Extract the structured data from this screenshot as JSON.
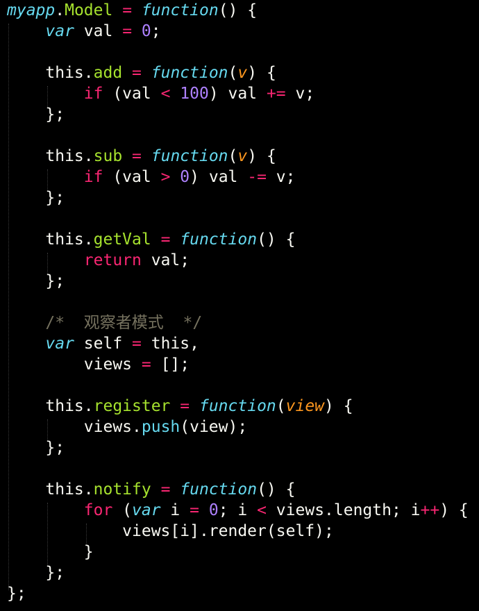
{
  "editor": {
    "lines": [
      [
        {
          "t": "myapp",
          "c": "obj"
        },
        {
          "t": ".",
          "c": "plain"
        },
        {
          "t": "Model",
          "c": "prop"
        },
        {
          "t": " ",
          "c": "plain"
        },
        {
          "t": "=",
          "c": "op"
        },
        {
          "t": " ",
          "c": "plain"
        },
        {
          "t": "function",
          "c": "fn"
        },
        {
          "t": "() {",
          "c": "plain"
        }
      ],
      [
        {
          "t": "    ",
          "c": "plain"
        },
        {
          "t": "var",
          "c": "kw"
        },
        {
          "t": " val ",
          "c": "plain"
        },
        {
          "t": "=",
          "c": "op"
        },
        {
          "t": " ",
          "c": "plain"
        },
        {
          "t": "0",
          "c": "num"
        },
        {
          "t": ";",
          "c": "plain"
        }
      ],
      [],
      [
        {
          "t": "    this.",
          "c": "plain"
        },
        {
          "t": "add",
          "c": "prop"
        },
        {
          "t": " ",
          "c": "plain"
        },
        {
          "t": "=",
          "c": "op"
        },
        {
          "t": " ",
          "c": "plain"
        },
        {
          "t": "function",
          "c": "fn"
        },
        {
          "t": "(",
          "c": "plain"
        },
        {
          "t": "v",
          "c": "param"
        },
        {
          "t": ") {",
          "c": "plain"
        }
      ],
      [
        {
          "t": "        ",
          "c": "plain"
        },
        {
          "t": "if",
          "c": "ctrl"
        },
        {
          "t": " (val ",
          "c": "plain"
        },
        {
          "t": "<",
          "c": "op"
        },
        {
          "t": " ",
          "c": "plain"
        },
        {
          "t": "100",
          "c": "num"
        },
        {
          "t": ") val ",
          "c": "plain"
        },
        {
          "t": "+=",
          "c": "op"
        },
        {
          "t": " v;",
          "c": "plain"
        }
      ],
      [
        {
          "t": "    };",
          "c": "plain"
        }
      ],
      [],
      [
        {
          "t": "    this.",
          "c": "plain"
        },
        {
          "t": "sub",
          "c": "prop"
        },
        {
          "t": " ",
          "c": "plain"
        },
        {
          "t": "=",
          "c": "op"
        },
        {
          "t": " ",
          "c": "plain"
        },
        {
          "t": "function",
          "c": "fn"
        },
        {
          "t": "(",
          "c": "plain"
        },
        {
          "t": "v",
          "c": "param"
        },
        {
          "t": ") {",
          "c": "plain"
        }
      ],
      [
        {
          "t": "        ",
          "c": "plain"
        },
        {
          "t": "if",
          "c": "ctrl"
        },
        {
          "t": " (val ",
          "c": "plain"
        },
        {
          "t": ">",
          "c": "op"
        },
        {
          "t": " ",
          "c": "plain"
        },
        {
          "t": "0",
          "c": "num"
        },
        {
          "t": ") val ",
          "c": "plain"
        },
        {
          "t": "-=",
          "c": "op"
        },
        {
          "t": " v;",
          "c": "plain"
        }
      ],
      [
        {
          "t": "    };",
          "c": "plain"
        }
      ],
      [],
      [
        {
          "t": "    this.",
          "c": "plain"
        },
        {
          "t": "getVal",
          "c": "prop"
        },
        {
          "t": " ",
          "c": "plain"
        },
        {
          "t": "=",
          "c": "op"
        },
        {
          "t": " ",
          "c": "plain"
        },
        {
          "t": "function",
          "c": "fn"
        },
        {
          "t": "() {",
          "c": "plain"
        }
      ],
      [
        {
          "t": "        ",
          "c": "plain"
        },
        {
          "t": "return",
          "c": "ctrl"
        },
        {
          "t": " val;",
          "c": "plain"
        }
      ],
      [
        {
          "t": "    };",
          "c": "plain"
        }
      ],
      [],
      [
        {
          "t": "    ",
          "c": "plain"
        },
        {
          "t": "/*  观察者模式  */",
          "c": "cmt"
        }
      ],
      [
        {
          "t": "    ",
          "c": "plain"
        },
        {
          "t": "var",
          "c": "kw"
        },
        {
          "t": " self ",
          "c": "plain"
        },
        {
          "t": "=",
          "c": "op"
        },
        {
          "t": " this,",
          "c": "plain"
        }
      ],
      [
        {
          "t": "        views ",
          "c": "plain"
        },
        {
          "t": "=",
          "c": "op"
        },
        {
          "t": " [];",
          "c": "plain"
        }
      ],
      [],
      [
        {
          "t": "    this.",
          "c": "plain"
        },
        {
          "t": "register",
          "c": "prop"
        },
        {
          "t": " ",
          "c": "plain"
        },
        {
          "t": "=",
          "c": "op"
        },
        {
          "t": " ",
          "c": "plain"
        },
        {
          "t": "function",
          "c": "fn"
        },
        {
          "t": "(",
          "c": "plain"
        },
        {
          "t": "view",
          "c": "param"
        },
        {
          "t": ") {",
          "c": "plain"
        }
      ],
      [
        {
          "t": "        views.",
          "c": "plain"
        },
        {
          "t": "push",
          "c": "meth"
        },
        {
          "t": "(view);",
          "c": "plain"
        }
      ],
      [
        {
          "t": "    };",
          "c": "plain"
        }
      ],
      [],
      [
        {
          "t": "    this.",
          "c": "plain"
        },
        {
          "t": "notify",
          "c": "prop"
        },
        {
          "t": " ",
          "c": "plain"
        },
        {
          "t": "=",
          "c": "op"
        },
        {
          "t": " ",
          "c": "plain"
        },
        {
          "t": "function",
          "c": "fn"
        },
        {
          "t": "() {",
          "c": "plain"
        }
      ],
      [
        {
          "t": "        ",
          "c": "plain"
        },
        {
          "t": "for",
          "c": "ctrl"
        },
        {
          "t": " (",
          "c": "plain"
        },
        {
          "t": "var",
          "c": "kw"
        },
        {
          "t": " i ",
          "c": "plain"
        },
        {
          "t": "=",
          "c": "op"
        },
        {
          "t": " ",
          "c": "plain"
        },
        {
          "t": "0",
          "c": "num"
        },
        {
          "t": "; i ",
          "c": "plain"
        },
        {
          "t": "<",
          "c": "op"
        },
        {
          "t": " views.length; i",
          "c": "plain"
        },
        {
          "t": "++",
          "c": "op"
        },
        {
          "t": ") {",
          "c": "plain"
        }
      ],
      [
        {
          "t": "            views[i].render(self);",
          "c": "plain"
        }
      ],
      [
        {
          "t": "        }",
          "c": "plain"
        }
      ],
      [
        {
          "t": "    };",
          "c": "plain"
        }
      ],
      [
        {
          "t": "};",
          "c": "plain"
        }
      ]
    ]
  },
  "colors": {
    "background": "#000000",
    "plain": "#f8f8f2",
    "keyword": "#66d9ef",
    "property": "#a6e22e",
    "operator": "#f92672",
    "number": "#ae81ff",
    "parameter": "#fd971f",
    "comment": "#75715e"
  }
}
